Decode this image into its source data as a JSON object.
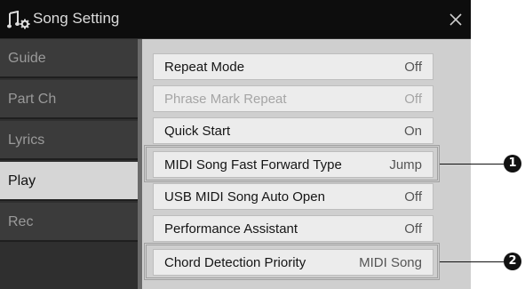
{
  "window": {
    "title": "Song Setting",
    "title_icon": "song-setting-icon",
    "close_icon": "close-icon",
    "close_glyph": "✕"
  },
  "sidebar": {
    "tabs": [
      {
        "label": "Guide",
        "active": false
      },
      {
        "label": "Part Ch",
        "active": false
      },
      {
        "label": "Lyrics",
        "active": false
      },
      {
        "label": "Play",
        "active": true
      },
      {
        "label": "Rec",
        "active": false
      }
    ]
  },
  "settings": [
    {
      "label": "Repeat Mode",
      "value": "Off",
      "enabled": true
    },
    {
      "label": "Phrase Mark Repeat",
      "value": "Off",
      "enabled": false
    },
    {
      "label": "Quick Start",
      "value": "On",
      "enabled": true
    },
    {
      "label": "MIDI Song Fast Forward Type",
      "value": "Jump",
      "enabled": true
    },
    {
      "label": "USB MIDI Song Auto Open",
      "value": "Off",
      "enabled": true
    },
    {
      "label": "Performance Assistant",
      "value": "Off",
      "enabled": true
    },
    {
      "label": "Chord Detection Priority",
      "value": "MIDI Song",
      "enabled": true
    }
  ],
  "callouts": [
    {
      "number": "1"
    },
    {
      "number": "2"
    }
  ],
  "colors": {
    "titlebar": "#0d0d0d",
    "sidebar_tab": "#3b3b3b",
    "active_tab": "#d6d6d6",
    "panel": "#cfcfcf",
    "row": "#ececec"
  }
}
